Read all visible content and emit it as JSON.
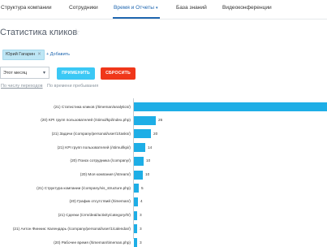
{
  "nav": {
    "items": [
      {
        "label": "Структура компании",
        "active": false
      },
      {
        "label": "Сотрудники",
        "active": false
      },
      {
        "label": "Время и Отчеты",
        "active": true
      },
      {
        "label": "База знаний",
        "active": false
      },
      {
        "label": "Видеоконференции",
        "active": false
      }
    ],
    "caret": "▾"
  },
  "page": {
    "title": "Статистика кликов",
    "star": "☆"
  },
  "filter": {
    "chip_label": "Юрий Гагарин",
    "chip_close": "✕",
    "add_label": "+ Добавить"
  },
  "controls": {
    "period_value": "Этот месяц",
    "period_arrow": "▾",
    "apply_label": "ПРИМЕНИТЬ",
    "reset_label": "СБРОСИТЬ"
  },
  "sort_tabs": {
    "by_clicks": "По числу переходов",
    "by_time": "По времени пребывания"
  },
  "colors": {
    "accent": "#2067b0",
    "bar": "#1eaee6",
    "apply": "#3bc8f5",
    "reset": "#f0371a"
  },
  "chart_data": {
    "type": "bar",
    "orientation": "horizontal",
    "categories": [
      "(21) Статистика кликов (/timeman/analytics/)",
      "(20) KPI групп пользователей (/stimul/kpi/index.php)",
      "(21) Задачи (/company/personal/user/1/tasks/)",
      "(21) KPI групп пользователей (/stimul/kpi/)",
      "(20) Поиск сотрудника (/company/)",
      "(20) Моя компания (/stream/)",
      "(21) Структура компании (/company/vis_structure.php)",
      "(20) График отсутствий (/timeman/)",
      "(21) Сделки (/crm/deal/activity/category/0/)",
      "(21) Антон Финник: Календарь (/company/personal/user/1/calendar/)",
      "(20) Рабочее время (/timeman/timeman.php)"
    ],
    "values": [
      null,
      26,
      20,
      14,
      10,
      10,
      5,
      4,
      3,
      3,
      3
    ],
    "value_labels": [
      "",
      "26",
      "20",
      "14",
      "10",
      "10",
      "5",
      "4",
      "3",
      "3",
      "3"
    ],
    "bar_lengths": [
      100,
      11.5,
      9,
      6,
      5,
      4.5,
      2.5,
      2,
      1.5,
      1.5,
      1.5
    ]
  }
}
